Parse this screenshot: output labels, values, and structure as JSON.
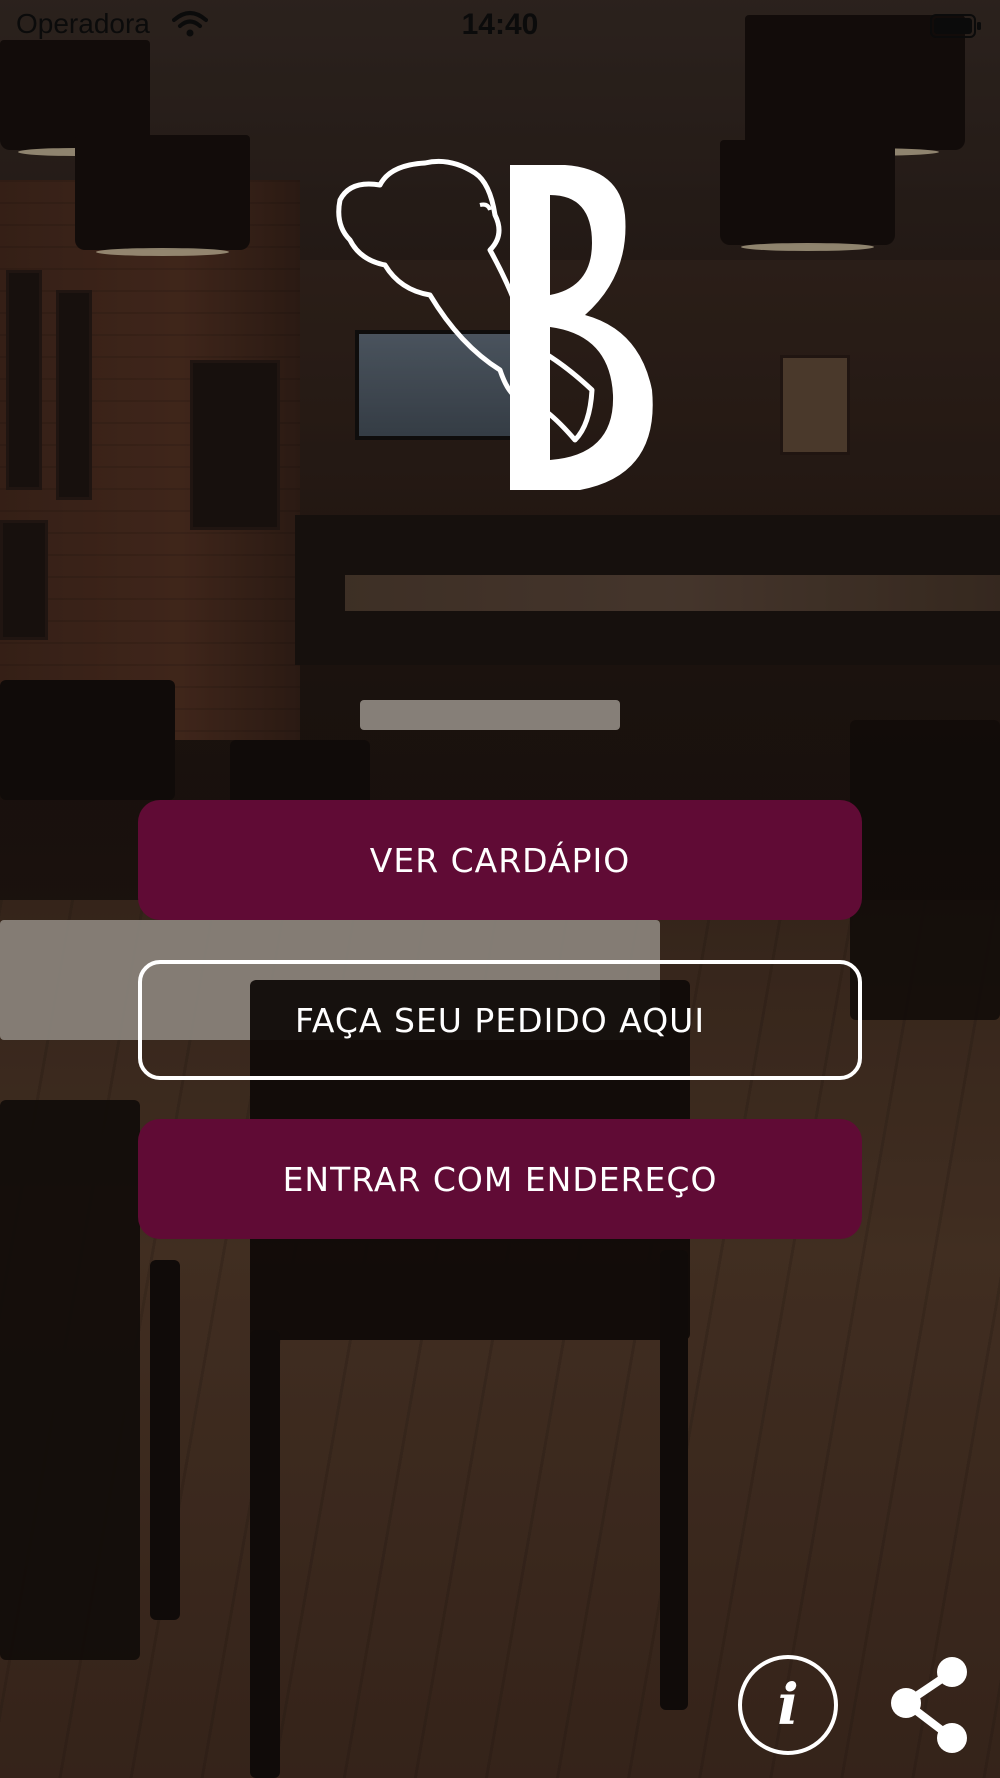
{
  "status_bar": {
    "carrier": "Operadora",
    "time": "14:40",
    "wifi_icon": "wifi-icon",
    "battery_icon": "battery-icon"
  },
  "logo": {
    "letter": "B",
    "icon": "bison-b-logo"
  },
  "actions": {
    "menu_label": "VER CARDÁPIO",
    "order_label": "FAÇA SEU PEDIDO AQUI",
    "address_label": "ENTRAR COM ENDEREÇO"
  },
  "footer": {
    "info_glyph": "i",
    "info_icon": "info-icon",
    "share_icon": "share-icon"
  },
  "colors": {
    "primary": "#600b35",
    "outline": "#ffffff"
  }
}
